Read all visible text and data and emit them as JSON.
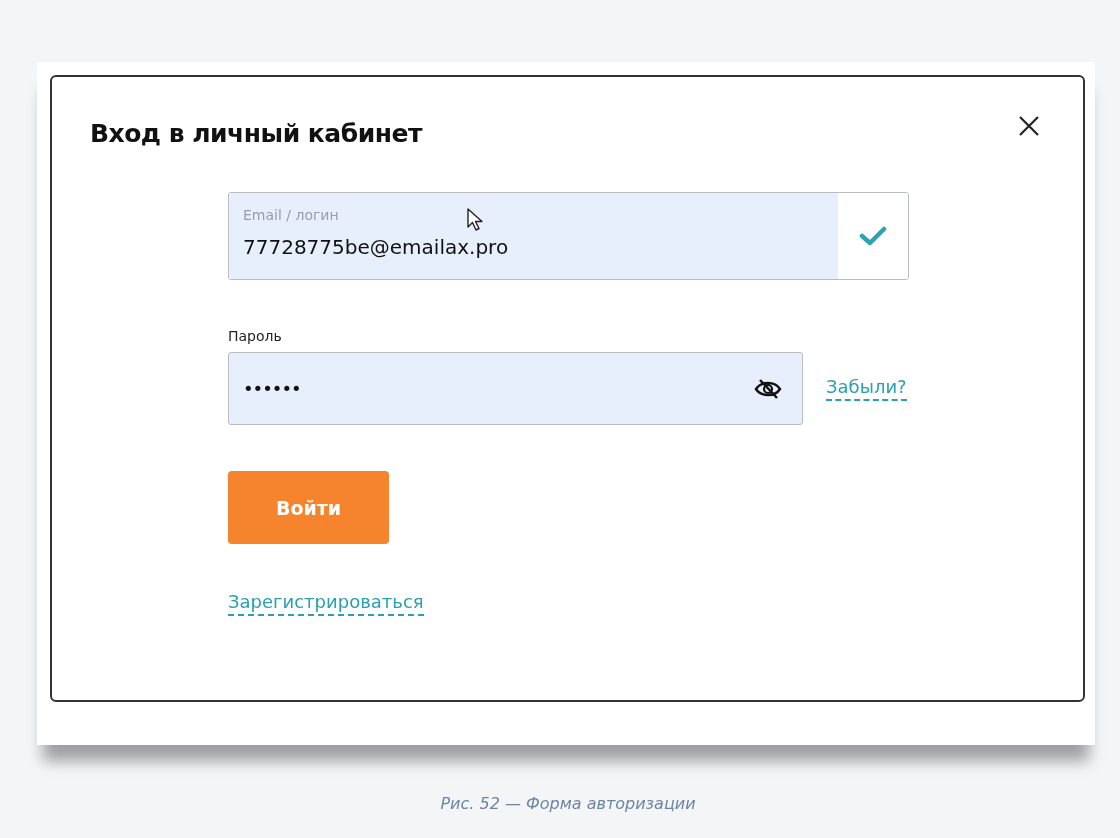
{
  "dialog": {
    "title": "Вход в личный кабинет"
  },
  "email": {
    "label": "Email / логин",
    "value": "77728775be@emailax.pro",
    "valid": true
  },
  "password": {
    "label": "Пароль",
    "value": "••••••",
    "hidden": true
  },
  "forgot_link": "Забыли?",
  "submit_button": "Войти",
  "register_link": "Зарегистрироваться",
  "caption": "Рис. 52 — Форма авторизации"
}
